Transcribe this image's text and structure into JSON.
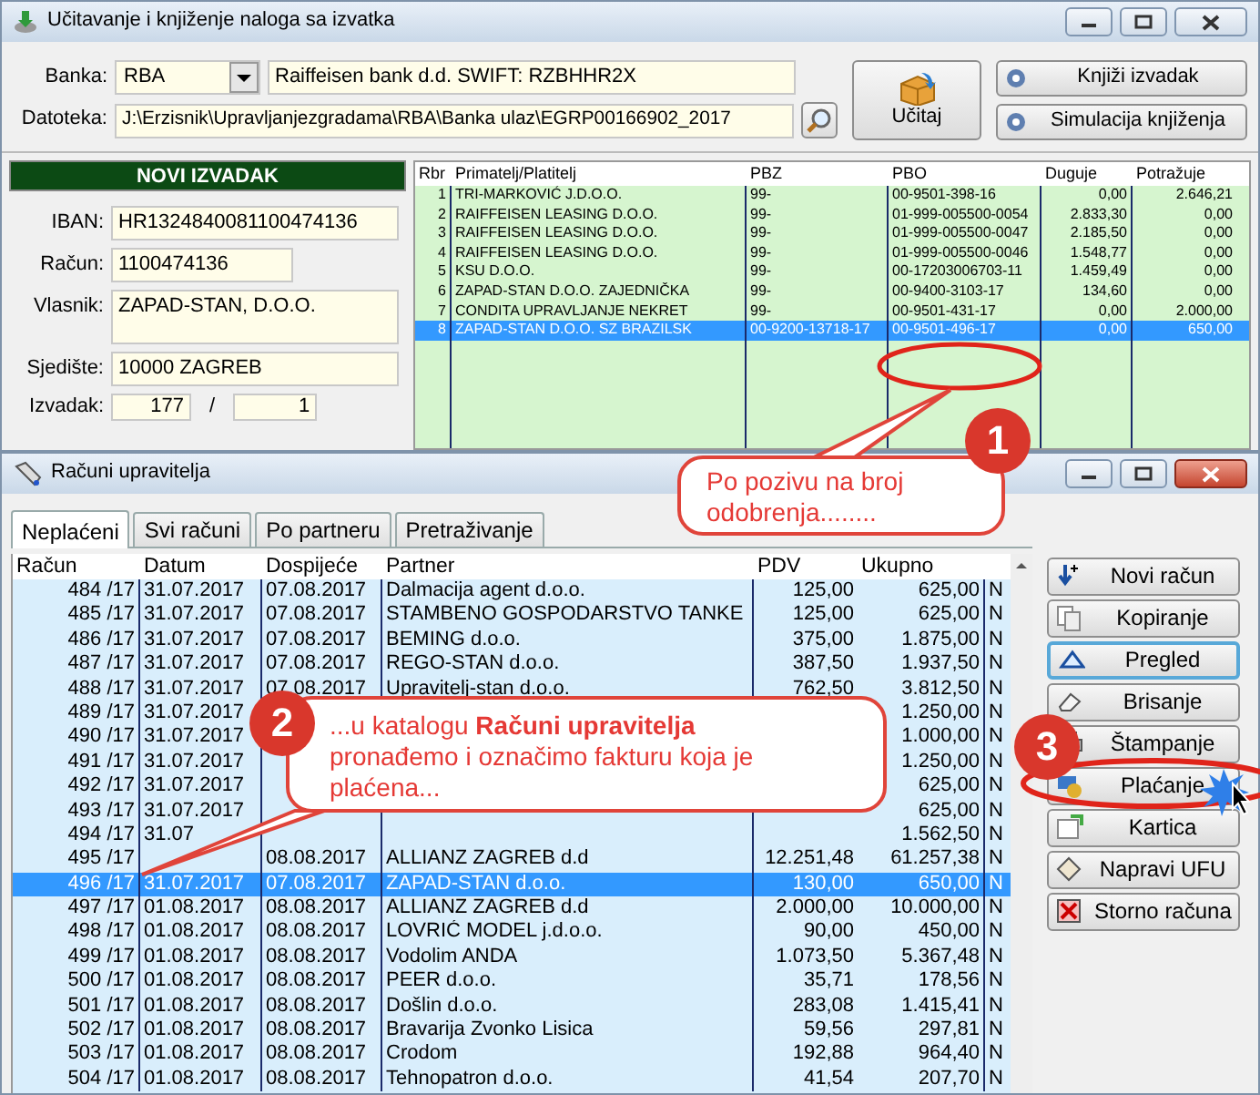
{
  "top_window": {
    "title": "Učitavanje i knjiženje naloga sa izvatka",
    "bank_label": "Banka:",
    "bank_code": "RBA",
    "bank_name": "Raiffeisen bank d.d. SWIFT: RZBHHR2X",
    "file_label": "Datoteka:",
    "file_path": "J:\\Erzisnik\\Upravljanjezgradama\\RBA\\Banka ulaz\\EGRP00166902_2017",
    "buttons": [
      {
        "label": "Učitaj",
        "kind": "large"
      },
      {
        "label": "Knjiži izvadak",
        "kind": "small"
      },
      {
        "label": "Simulacija knjiženja",
        "kind": "small"
      }
    ],
    "statement": {
      "header": "NOVI IZVADAK",
      "fields": [
        {
          "label": "IBAN:",
          "value": "HR1324840081100474136",
          "kind": "wide"
        },
        {
          "label": "Račun:",
          "value": "1100474136",
          "kind": "short"
        },
        {
          "label": "Vlasnik:",
          "value": "ZAPAD-STAN, D.O.O.",
          "kind": "tall"
        },
        {
          "label": "Sjedište:",
          "value": "10000 ZAGREB",
          "kind": "wide"
        }
      ],
      "izvadak_label": "Izvadak:",
      "izvadak_number": "177",
      "separator": "/",
      "izvadak_page": "1"
    },
    "grid": {
      "columns": [
        "Rbr",
        "Primatelj/Platitelj",
        "PBZ",
        "PBO",
        "Duguje",
        "Potražuje"
      ],
      "rows": [
        {
          "cells": [
            "1",
            "TRI-MARKOVIĆ J.D.O.O.",
            "99-",
            "00-9501-398-16",
            "0,00",
            "2.646,21"
          ],
          "selected": false
        },
        {
          "cells": [
            "2",
            "RAIFFEISEN LEASING D.O.O.",
            "99-",
            "01-999-005500-0054",
            "2.833,30",
            "0,00"
          ],
          "selected": false
        },
        {
          "cells": [
            "3",
            "RAIFFEISEN LEASING D.O.O.",
            "99-",
            "01-999-005500-0047",
            "2.185,50",
            "0,00"
          ],
          "selected": false
        },
        {
          "cells": [
            "4",
            "RAIFFEISEN LEASING D.O.O.",
            "99-",
            "01-999-005500-0046",
            "1.548,77",
            "0,00"
          ],
          "selected": false
        },
        {
          "cells": [
            "5",
            "KSU D.O.O.",
            "99-",
            "00-17203006703-11",
            "1.459,49",
            "0,00"
          ],
          "selected": false
        },
        {
          "cells": [
            "6",
            "ZAPAD-STAN D.O.O. ZAJEDNIČKA",
            "99-",
            "00-9400-3103-17",
            "134,60",
            "0,00"
          ],
          "selected": false
        },
        {
          "cells": [
            "7",
            "CONDITA UPRAVLJANJE NEKRET",
            "99-",
            "00-9501-431-17",
            "0,00",
            "2.000,00"
          ],
          "selected": false
        },
        {
          "cells": [
            "8",
            "ZAPAD-STAN D.O.O. SZ BRAZILSK",
            "00-9200-13718-17",
            "00-9501-496-17",
            "0,00",
            "650,00"
          ],
          "selected": true
        }
      ]
    }
  },
  "bottom_window": {
    "title": "Računi upravitelja",
    "tabs": [
      {
        "label": "Neplaćeni",
        "selected": true
      },
      {
        "label": "Svi računi",
        "selected": false
      },
      {
        "label": "Po partneru",
        "selected": false
      },
      {
        "label": "Pretraživanje",
        "selected": false
      }
    ],
    "table": {
      "columns": [
        "Račun",
        "Datum",
        "Dospijeće",
        "Partner",
        "PDV",
        "Ukupno"
      ],
      "rows": [
        {
          "racun": "484 /17",
          "datum": "31.07.2017",
          "dospijece": "07.08.2017",
          "partner": "Dalmacija agent d.o.o.",
          "pdv": "125,00",
          "ukupno": "625,00",
          "column_7": "N",
          "selected": false
        },
        {
          "racun": "485 /17",
          "datum": "31.07.2017",
          "dospijece": "07.08.2017",
          "partner": "STAMBENO GOSPODARSTVO TANKE",
          "pdv": "125,00",
          "ukupno": "625,00",
          "column_7": "N",
          "selected": false
        },
        {
          "racun": "486 /17",
          "datum": "31.07.2017",
          "dospijece": "07.08.2017",
          "partner": "BEMING d.o.o.",
          "pdv": "375,00",
          "ukupno": "1.875,00",
          "column_7": "N",
          "selected": false
        },
        {
          "racun": "487 /17",
          "datum": "31.07.2017",
          "dospijece": "07.08.2017",
          "partner": "REGO-STAN d.o.o.",
          "pdv": "387,50",
          "ukupno": "1.937,50",
          "column_7": "N",
          "selected": false
        },
        {
          "racun": "488 /17",
          "datum": "31.07.2017",
          "dospijece": "07.08.2017",
          "partner": "Upravitelj-stan d.o.o.",
          "pdv": "762,50",
          "ukupno": "3.812,50",
          "column_7": "N",
          "selected": false
        },
        {
          "racun": "489 /17",
          "datum": "31.07.2017",
          "ukupno": "1.250,00",
          "column_7": "N",
          "selected": false
        },
        {
          "racun": "490 /17",
          "datum": "31.07.2017",
          "ukupno": "1.000,00",
          "column_7": "N",
          "selected": false
        },
        {
          "racun": "491 /17",
          "datum": "31.07.2017",
          "ukupno": "1.250,00",
          "column_7": "N",
          "selected": false
        },
        {
          "racun": "492 /17",
          "datum": "31.07.2017",
          "ukupno": "625,00",
          "column_7": "N",
          "selected": false
        },
        {
          "racun": "493 /17",
          "datum": "31.07.2017",
          "ukupno": "625,00",
          "column_7": "N",
          "selected": false
        },
        {
          "racun": "494 /17",
          "datum": "31.07",
          "ukupno": "1.562,50",
          "column_7": "N",
          "selected": false
        },
        {
          "racun": "495 /17",
          "dospijece": "08.08.2017",
          "partner": "ALLIANZ ZAGREB d.d",
          "pdv": "12.251,48",
          "ukupno": "61.257,38",
          "column_7": "N",
          "selected": false
        },
        {
          "racun": "496 /17",
          "datum": "31.07.2017",
          "dospijece": "07.08.2017",
          "partner": "ZAPAD-STAN d.o.o.",
          "pdv": "130,00",
          "ukupno": "650,00",
          "column_7": "N",
          "selected": true
        },
        {
          "racun": "497 /17",
          "datum": "01.08.2017",
          "dospijece": "08.08.2017",
          "partner": "ALLIANZ ZAGREB d.d",
          "pdv": "2.000,00",
          "ukupno": "10.000,00",
          "column_7": "N",
          "selected": false
        },
        {
          "racun": "498 /17",
          "datum": "01.08.2017",
          "dospijece": "08.08.2017",
          "partner": "LOVRIĆ MODEL j.d.o.o.",
          "pdv": "90,00",
          "ukupno": "450,00",
          "column_7": "N",
          "selected": false
        },
        {
          "racun": "499 /17",
          "datum": "01.08.2017",
          "dospijece": "08.08.2017",
          "partner": "Vodolim ANDA",
          "pdv": "1.073,50",
          "ukupno": "5.367,48",
          "column_7": "N",
          "selected": false
        },
        {
          "racun": "500 /17",
          "datum": "01.08.2017",
          "dospijece": "08.08.2017",
          "partner": "PEER d.o.o.",
          "pdv": "35,71",
          "ukupno": "178,56",
          "column_7": "N",
          "selected": false
        },
        {
          "racun": "501 /17",
          "datum": "01.08.2017",
          "dospijece": "08.08.2017",
          "partner": "Došlin d.o.o.",
          "pdv": "283,08",
          "ukupno": "1.415,41",
          "column_7": "N",
          "selected": false
        },
        {
          "racun": "502 /17",
          "datum": "01.08.2017",
          "dospijece": "08.08.2017",
          "partner": "Bravarija Zvonko Lisica",
          "pdv": "59,56",
          "ukupno": "297,81",
          "column_7": "N",
          "selected": false
        },
        {
          "racun": "503 /17",
          "datum": "01.08.2017",
          "dospijece": "08.08.2017",
          "partner": "Crodom",
          "pdv": "192,88",
          "ukupno": "964,40",
          "column_7": "N",
          "selected": false
        },
        {
          "racun": "504 /17",
          "datum": "01.08.2017",
          "dospijece": "08.08.2017",
          "partner": "Tehnopatron d.o.o.",
          "pdv": "41,54",
          "ukupno": "207,70",
          "column_7": "N",
          "selected": false
        }
      ]
    },
    "buttons": [
      {
        "label": "Novi račun",
        "focused": false
      },
      {
        "label": "Kopiranje",
        "focused": false
      },
      {
        "label": "Pregled",
        "focused": true
      },
      {
        "label": "Brisanje",
        "focused": false
      },
      {
        "label": "Štampanje",
        "focused": false
      },
      {
        "label": "Plaćanje",
        "focused": false
      },
      {
        "label": "Kartica",
        "focused": false
      },
      {
        "label": "Napravi UFU",
        "focused": false
      },
      {
        "label": "Storno računa",
        "focused": false
      }
    ]
  },
  "callouts": [
    {
      "number": "1",
      "text": "Po pozivu na broj odobrenja........"
    },
    {
      "number": "2",
      "text": "...u katalogu **Računi upravitelja** pronađemo i označimo fakturu koja je plaćena..."
    },
    {
      "number": "3"
    }
  ]
}
